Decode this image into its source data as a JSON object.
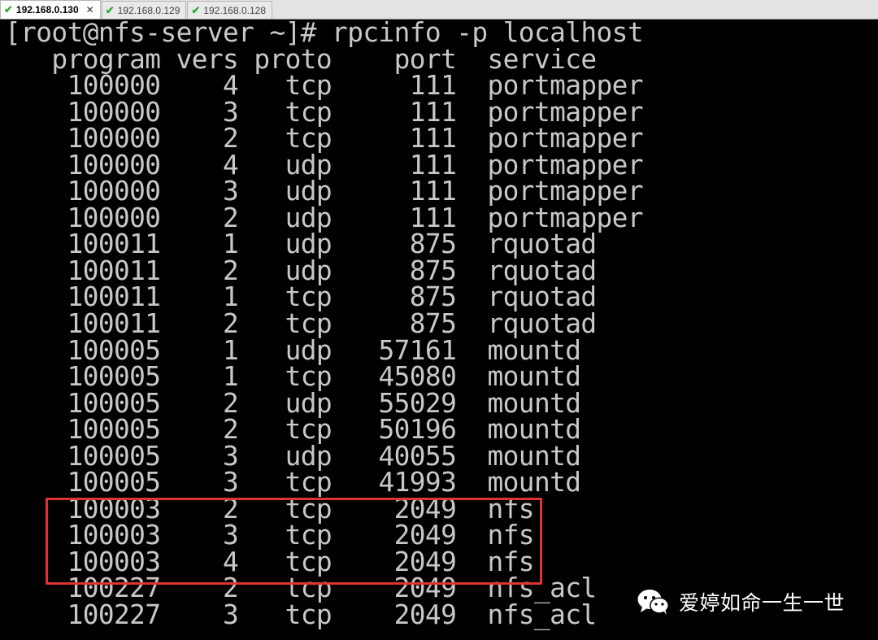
{
  "tabs": [
    {
      "label": "192.168.0.130",
      "active": true
    },
    {
      "label": "192.168.0.129",
      "active": false
    },
    {
      "label": "192.168.0.128",
      "active": false
    }
  ],
  "terminal": {
    "prompt": "[root@nfs-server ~]# rpcinfo -p localhost",
    "columns": [
      "program",
      "vers",
      "proto",
      "port",
      "service"
    ],
    "rows": [
      [
        "100000",
        "4",
        "tcp",
        "111",
        "portmapper"
      ],
      [
        "100000",
        "3",
        "tcp",
        "111",
        "portmapper"
      ],
      [
        "100000",
        "2",
        "tcp",
        "111",
        "portmapper"
      ],
      [
        "100000",
        "4",
        "udp",
        "111",
        "portmapper"
      ],
      [
        "100000",
        "3",
        "udp",
        "111",
        "portmapper"
      ],
      [
        "100000",
        "2",
        "udp",
        "111",
        "portmapper"
      ],
      [
        "100011",
        "1",
        "udp",
        "875",
        "rquotad"
      ],
      [
        "100011",
        "2",
        "udp",
        "875",
        "rquotad"
      ],
      [
        "100011",
        "1",
        "tcp",
        "875",
        "rquotad"
      ],
      [
        "100011",
        "2",
        "tcp",
        "875",
        "rquotad"
      ],
      [
        "100005",
        "1",
        "udp",
        "57161",
        "mountd"
      ],
      [
        "100005",
        "1",
        "tcp",
        "45080",
        "mountd"
      ],
      [
        "100005",
        "2",
        "udp",
        "55029",
        "mountd"
      ],
      [
        "100005",
        "2",
        "tcp",
        "50196",
        "mountd"
      ],
      [
        "100005",
        "3",
        "udp",
        "40055",
        "mountd"
      ],
      [
        "100005",
        "3",
        "tcp",
        "41993",
        "mountd"
      ],
      [
        "100003",
        "2",
        "tcp",
        "2049",
        "nfs"
      ],
      [
        "100003",
        "3",
        "tcp",
        "2049",
        "nfs"
      ],
      [
        "100003",
        "4",
        "tcp",
        "2049",
        "nfs"
      ],
      [
        "100227",
        "2",
        "tcp",
        "2049",
        "nfs_acl"
      ],
      [
        "100227",
        "3",
        "tcp",
        "2049",
        "nfs_acl"
      ]
    ]
  },
  "watermark": {
    "text": "爱婷如命一生一世",
    "icon": "wechat-icon"
  },
  "colors": {
    "terminal_bg": "#000000",
    "terminal_fg": "#c8c8c8",
    "highlight": "#e03333",
    "tab_check": "#33aa33"
  }
}
